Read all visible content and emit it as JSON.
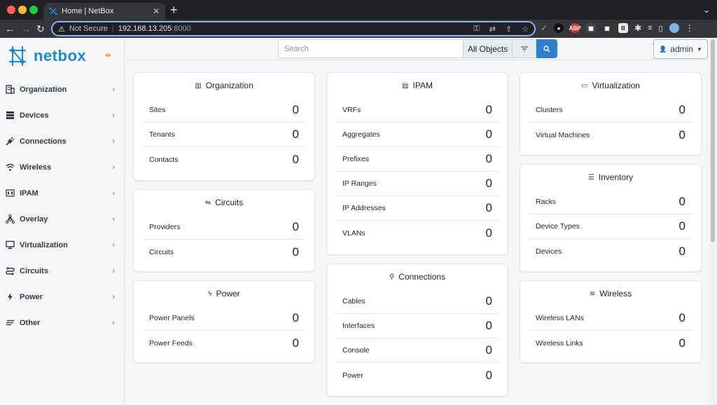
{
  "browser": {
    "tab_title": "Home | NetBox",
    "new_tab": "+",
    "address_warning": "Not Secure",
    "address_host": "192.168.13.205",
    "address_port": ":8000"
  },
  "sidebar": {
    "logo_text": "netbox",
    "items": [
      {
        "label": "Organization",
        "icon": "building-icon"
      },
      {
        "label": "Devices",
        "icon": "server-icon"
      },
      {
        "label": "Connections",
        "icon": "plug-icon"
      },
      {
        "label": "Wireless",
        "icon": "wifi-icon"
      },
      {
        "label": "IPAM",
        "icon": "counter-icon"
      },
      {
        "label": "Overlay",
        "icon": "graph-icon"
      },
      {
        "label": "Virtualization",
        "icon": "monitor-icon"
      },
      {
        "label": "Circuits",
        "icon": "transit-icon"
      },
      {
        "label": "Power",
        "icon": "flash-icon"
      },
      {
        "label": "Other",
        "icon": "notes-icon"
      }
    ]
  },
  "topbar": {
    "search_placeholder": "Search",
    "scope": "All Objects",
    "user": "admin"
  },
  "cards": {
    "organization": {
      "title": "Organization",
      "rows": [
        {
          "label": "Sites",
          "count": "0"
        },
        {
          "label": "Tenants",
          "count": "0"
        },
        {
          "label": "Contacts",
          "count": "0"
        }
      ]
    },
    "circuits": {
      "title": "Circuits",
      "rows": [
        {
          "label": "Providers",
          "count": "0"
        },
        {
          "label": "Circuits",
          "count": "0"
        }
      ]
    },
    "power": {
      "title": "Power",
      "rows": [
        {
          "label": "Power Panels",
          "count": "0"
        },
        {
          "label": "Power Feeds",
          "count": "0"
        }
      ]
    },
    "ipam": {
      "title": "IPAM",
      "rows": [
        {
          "label": "VRFs",
          "count": "0"
        },
        {
          "label": "Aggregates",
          "count": "0"
        },
        {
          "label": "Prefixes",
          "count": "0"
        },
        {
          "label": "IP Ranges",
          "count": "0"
        },
        {
          "label": "IP Addresses",
          "count": "0"
        },
        {
          "label": "VLANs",
          "count": "0"
        }
      ]
    },
    "connections": {
      "title": "Connections",
      "rows": [
        {
          "label": "Cables",
          "count": "0"
        },
        {
          "label": "Interfaces",
          "count": "0"
        },
        {
          "label": "Console",
          "count": "0"
        },
        {
          "label": "Power",
          "count": "0"
        }
      ]
    },
    "virtualization": {
      "title": "Virtualization",
      "rows": [
        {
          "label": "Clusters",
          "count": "0"
        },
        {
          "label": "Virtual Machines",
          "count": "0"
        }
      ]
    },
    "inventory": {
      "title": "Inventory",
      "rows": [
        {
          "label": "Racks",
          "count": "0"
        },
        {
          "label": "Device Types",
          "count": "0"
        },
        {
          "label": "Devices",
          "count": "0"
        }
      ]
    },
    "wireless": {
      "title": "Wireless",
      "rows": [
        {
          "label": "Wireless LANs",
          "count": "0"
        },
        {
          "label": "Wireless Links",
          "count": "0"
        }
      ]
    }
  },
  "colors": {
    "brand": "#1b88d8",
    "search_button": "#2f7fcf"
  }
}
